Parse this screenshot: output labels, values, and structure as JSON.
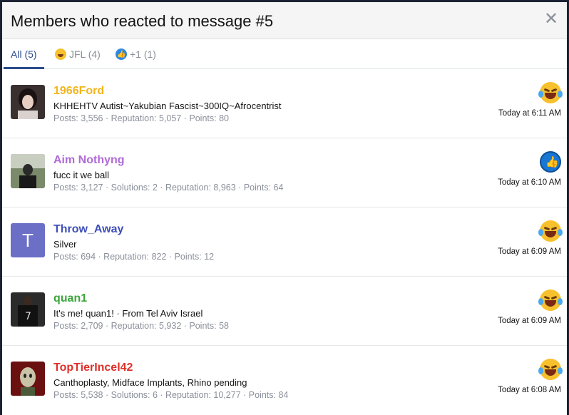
{
  "dialog": {
    "title": "Members who reacted to message #5",
    "close_label": "✕"
  },
  "tabs": [
    {
      "label": "All (5)",
      "icon": null
    },
    {
      "label": "JFL (4)",
      "icon": "laughing-crying-emoji-icon"
    },
    {
      "label": "+1 (1)",
      "icon": "thumbs-up-icon"
    }
  ],
  "members": [
    {
      "name": "1966Ford",
      "name_color": "#f2b51b",
      "subtitle": "KHHEHTV Autist~Yakubian Fascist~300IQ~Afrocentrist",
      "stats": "Posts: 3,556 · Reputation: 5,057 · Points: 80",
      "reaction": "laughing-crying-emoji-icon",
      "time": "Today at 6:11 AM",
      "avatar": "photo"
    },
    {
      "name": "Aim Nothyng",
      "name_color": "#b06ad9",
      "subtitle": "fucc it we ball",
      "stats": "Posts: 3,127 · Solutions: 2 · Reputation: 8,963 · Points: 64",
      "reaction": "thumbs-up-icon",
      "time": "Today at 6:10 AM",
      "avatar": "photo"
    },
    {
      "name": "Throw_Away",
      "name_color": "#3f4fb8",
      "subtitle": "Silver",
      "stats": "Posts: 694 · Reputation: 822 · Points: 12",
      "reaction": "laughing-crying-emoji-icon",
      "time": "Today at 6:09 AM",
      "avatar": "T"
    },
    {
      "name": "quan1",
      "name_color": "#3aa63a",
      "subtitle": "It's me! quan1! · From Tel Aviv Israel",
      "stats": "Posts: 2,709 · Reputation: 5,932 · Points: 58",
      "reaction": "laughing-crying-emoji-icon",
      "time": "Today at 6:09 AM",
      "avatar": "photo"
    },
    {
      "name": "TopTierIncel42",
      "name_color": "#e0302a",
      "subtitle": "Canthoplasty, Midface Implants, Rhino pending",
      "stats": "Posts: 5,538 · Solutions: 6 · Reputation: 10,277 · Points: 84",
      "reaction": "laughing-crying-emoji-icon",
      "time": "Today at 6:08 AM",
      "avatar": "photo"
    }
  ]
}
